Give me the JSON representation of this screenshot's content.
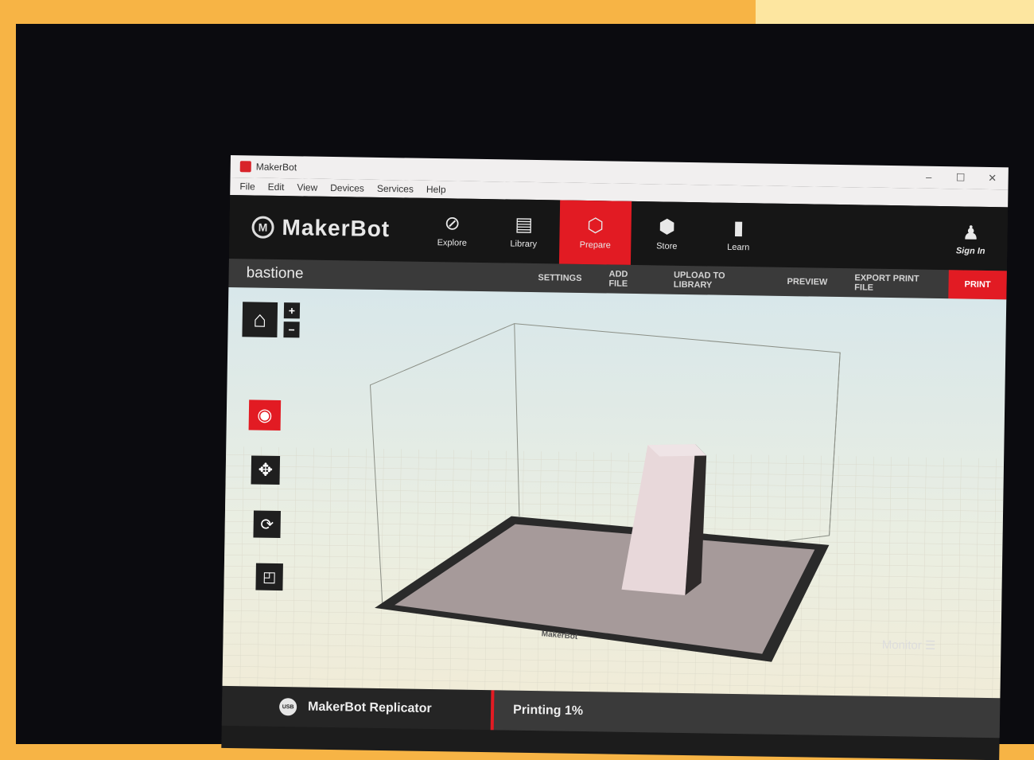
{
  "window": {
    "title": "MakerBot",
    "controls": [
      "–",
      "☐",
      "✕"
    ]
  },
  "menu": [
    "File",
    "Edit",
    "View",
    "Devices",
    "Services",
    "Help"
  ],
  "brand": {
    "mark": "M",
    "name": "MakerBot"
  },
  "nav": [
    {
      "label": "Explore",
      "icon": "compass-icon",
      "glyph": "⊘"
    },
    {
      "label": "Library",
      "icon": "library-icon",
      "glyph": "▤"
    },
    {
      "label": "Prepare",
      "icon": "prepare-icon",
      "glyph": "⬡",
      "active": true
    },
    {
      "label": "Store",
      "icon": "cube-icon",
      "glyph": "⬢"
    },
    {
      "label": "Learn",
      "icon": "book-icon",
      "glyph": "▮"
    }
  ],
  "signin": {
    "label": "Sign In",
    "glyph": "♟"
  },
  "project": {
    "name": "bastione"
  },
  "actions": [
    "SETTINGS",
    "ADD FILE",
    "UPLOAD TO LIBRARY",
    "PREVIEW",
    "EXPORT PRINT FILE",
    "PRINT"
  ],
  "tools": {
    "home": "⌂",
    "zoom_in": "+",
    "zoom_out": "−",
    "view": "◉",
    "move": "✥",
    "rotate": "⟳",
    "scale": "◰"
  },
  "plate_logo": "MakerBot",
  "bottom": {
    "usb": "USB",
    "printer": "MakerBot Replicator",
    "status": "Printing 1%",
    "monitor": "Monitor ☰"
  },
  "colors": {
    "accent": "#e21b23",
    "bar": "#161616"
  }
}
